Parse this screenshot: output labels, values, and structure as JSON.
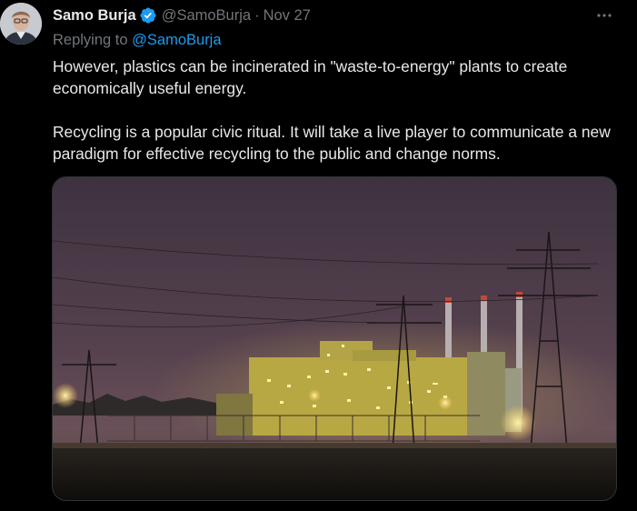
{
  "tweet": {
    "author_name": "Samo Burja",
    "handle": "@SamoBurja",
    "separator": "·",
    "date": "Nov 27",
    "verified": true,
    "replying_prefix": "Replying to",
    "replying_handle": "@SamoBurja",
    "paragraphs": [
      "However, plastics can be incinerated in \"waste-to-energy\" plants to create economically useful energy.",
      "Recycling is a popular civic ritual. It will take a live player to communicate a new paradigm for effective recycling to the public and change norms."
    ]
  },
  "icons": {
    "avatar": "avatar-photo",
    "verified": "verified-badge-icon",
    "more": "more-options-icon"
  },
  "colors": {
    "background": "#000000",
    "text": "#e7e9ea",
    "secondary": "#71767b",
    "accent": "#1d9bf0"
  }
}
